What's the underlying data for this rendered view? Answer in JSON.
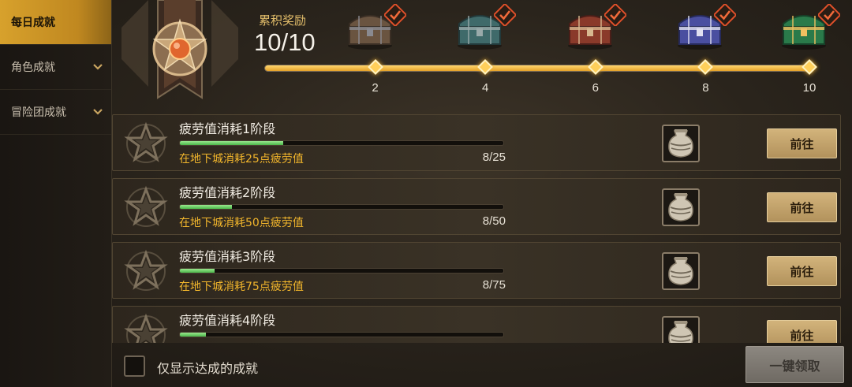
{
  "sidebar": {
    "items": [
      {
        "label": "每日成就",
        "active": true
      },
      {
        "label": "角色成就",
        "active": false
      },
      {
        "label": "冒险团成就",
        "active": false
      }
    ]
  },
  "header": {
    "reward_title": "累积奖励",
    "progress_count": "10/10",
    "progress_fraction": 1.0,
    "milestones": [
      {
        "value": "2",
        "chest": "brown-chest-icon",
        "claimed": true
      },
      {
        "value": "4",
        "chest": "teal-chest-icon",
        "claimed": true
      },
      {
        "value": "6",
        "chest": "red-chest-icon",
        "claimed": true
      },
      {
        "value": "8",
        "chest": "blue-chest-icon",
        "claimed": true
      },
      {
        "value": "10",
        "chest": "green-gem-chest-icon",
        "claimed": true
      }
    ]
  },
  "achievements": [
    {
      "title": "疲劳值消耗1阶段",
      "desc": "在地下城消耗25点疲劳值",
      "count": "8/25",
      "progress": 0.32,
      "button": "前往",
      "reward_icon": "jar-icon"
    },
    {
      "title": "疲劳值消耗2阶段",
      "desc": "在地下城消耗50点疲劳值",
      "count": "8/50",
      "progress": 0.16,
      "button": "前往",
      "reward_icon": "jar-icon"
    },
    {
      "title": "疲劳值消耗3阶段",
      "desc": "在地下城消耗75点疲劳值",
      "count": "8/75",
      "progress": 0.107,
      "button": "前往",
      "reward_icon": "jar-icon"
    },
    {
      "title": "疲劳值消耗4阶段",
      "desc": "",
      "count": "",
      "progress": 0.08,
      "button": "前往",
      "reward_icon": "jar-icon"
    }
  ],
  "footer": {
    "filter_label": "仅显示达成的成就",
    "claim_all_label": "一键领取"
  },
  "colors": {
    "accent_gold": "#d7a12c",
    "desc_text": "#f2b62c",
    "progress_green": "#4bb84a"
  }
}
